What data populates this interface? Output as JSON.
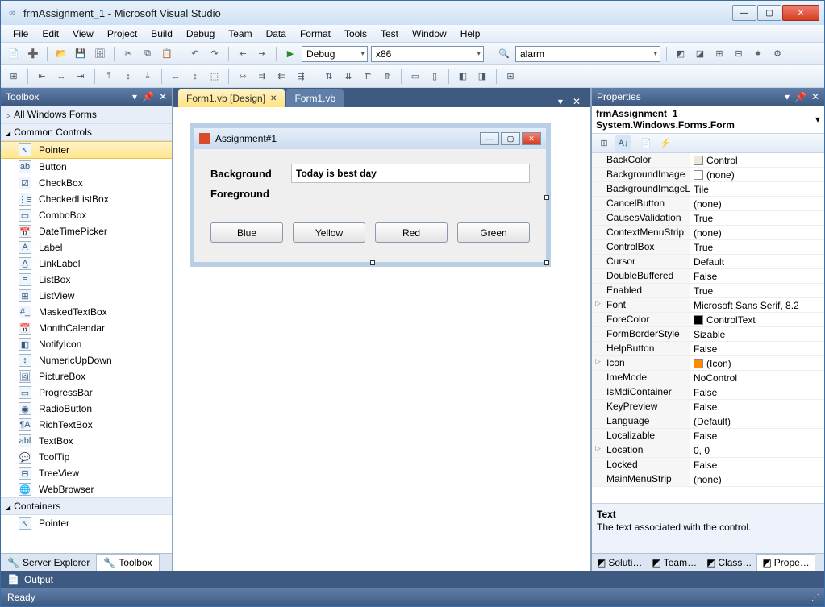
{
  "window": {
    "title": "frmAssignment_1 - Microsoft Visual Studio"
  },
  "menu": [
    "File",
    "Edit",
    "View",
    "Project",
    "Build",
    "Debug",
    "Team",
    "Data",
    "Format",
    "Tools",
    "Test",
    "Window",
    "Help"
  ],
  "toolbar1": {
    "config": "Debug",
    "platform": "x86",
    "search_value": "alarm"
  },
  "toolbox": {
    "title": "Toolbox",
    "groups": [
      {
        "label": "All Windows Forms",
        "expanded": false
      },
      {
        "label": "Common Controls",
        "expanded": true,
        "items": [
          {
            "label": "Pointer",
            "icon": "↖",
            "selected": true
          },
          {
            "label": "Button",
            "icon": "ab"
          },
          {
            "label": "CheckBox",
            "icon": "☑"
          },
          {
            "label": "CheckedListBox",
            "icon": "⋮≡"
          },
          {
            "label": "ComboBox",
            "icon": "▭"
          },
          {
            "label": "DateTimePicker",
            "icon": "📅"
          },
          {
            "label": "Label",
            "icon": "A"
          },
          {
            "label": "LinkLabel",
            "icon": "A̲"
          },
          {
            "label": "ListBox",
            "icon": "≡"
          },
          {
            "label": "ListView",
            "icon": "⊞"
          },
          {
            "label": "MaskedTextBox",
            "icon": "#_"
          },
          {
            "label": "MonthCalendar",
            "icon": "📅"
          },
          {
            "label": "NotifyIcon",
            "icon": "◧"
          },
          {
            "label": "NumericUpDown",
            "icon": "↕"
          },
          {
            "label": "PictureBox",
            "icon": "🖼"
          },
          {
            "label": "ProgressBar",
            "icon": "▭"
          },
          {
            "label": "RadioButton",
            "icon": "◉"
          },
          {
            "label": "RichTextBox",
            "icon": "¶A"
          },
          {
            "label": "TextBox",
            "icon": "abl"
          },
          {
            "label": "ToolTip",
            "icon": "💬"
          },
          {
            "label": "TreeView",
            "icon": "⊟"
          },
          {
            "label": "WebBrowser",
            "icon": "🌐"
          }
        ]
      },
      {
        "label": "Containers",
        "expanded": true,
        "items": [
          {
            "label": "Pointer",
            "icon": "↖"
          }
        ]
      }
    ],
    "bottom_tabs": [
      {
        "label": "Server Explorer",
        "active": false
      },
      {
        "label": "Toolbox",
        "active": true
      }
    ]
  },
  "docs": {
    "tabs": [
      {
        "label": "Form1.vb [Design]",
        "active": true
      },
      {
        "label": "Form1.vb",
        "active": false
      }
    ]
  },
  "form": {
    "title": "Assignment#1",
    "label1": "Background",
    "label2": "Foreground",
    "textbox_value": "Today is best day",
    "buttons": [
      "Blue",
      "Yellow",
      "Red",
      "Green"
    ]
  },
  "properties": {
    "title": "Properties",
    "object": "frmAssignment_1 System.Windows.Forms.Form",
    "rows": [
      {
        "name": "BackColor",
        "value": "Control",
        "swatch": "#ece9d8"
      },
      {
        "name": "BackgroundImage",
        "value": "(none)",
        "swatch": "#ffffff"
      },
      {
        "name": "BackgroundImageLa",
        "value": "Tile"
      },
      {
        "name": "CancelButton",
        "value": "(none)"
      },
      {
        "name": "CausesValidation",
        "value": "True"
      },
      {
        "name": "ContextMenuStrip",
        "value": "(none)"
      },
      {
        "name": "ControlBox",
        "value": "True"
      },
      {
        "name": "Cursor",
        "value": "Default"
      },
      {
        "name": "DoubleBuffered",
        "value": "False"
      },
      {
        "name": "Enabled",
        "value": "True"
      },
      {
        "name": "Font",
        "value": "Microsoft Sans Serif, 8.2",
        "expand": true
      },
      {
        "name": "ForeColor",
        "value": "ControlText",
        "swatch": "#000000"
      },
      {
        "name": "FormBorderStyle",
        "value": "Sizable"
      },
      {
        "name": "HelpButton",
        "value": "False"
      },
      {
        "name": "Icon",
        "value": "(Icon)",
        "swatch": "#ff8c00",
        "expand": true
      },
      {
        "name": "ImeMode",
        "value": "NoControl"
      },
      {
        "name": "IsMdiContainer",
        "value": "False"
      },
      {
        "name": "KeyPreview",
        "value": "False"
      },
      {
        "name": "Language",
        "value": "(Default)"
      },
      {
        "name": "Localizable",
        "value": "False"
      },
      {
        "name": "Location",
        "value": "0, 0",
        "expand": true
      },
      {
        "name": "Locked",
        "value": "False"
      },
      {
        "name": "MainMenuStrip",
        "value": "(none)"
      }
    ],
    "desc_title": "Text",
    "desc_body": "The text associated with the control.",
    "bottom_tabs": [
      {
        "label": "Soluti…"
      },
      {
        "label": "Team…"
      },
      {
        "label": "Class…"
      },
      {
        "label": "Prope…",
        "active": true
      }
    ]
  },
  "output_label": "Output",
  "status": "Ready"
}
